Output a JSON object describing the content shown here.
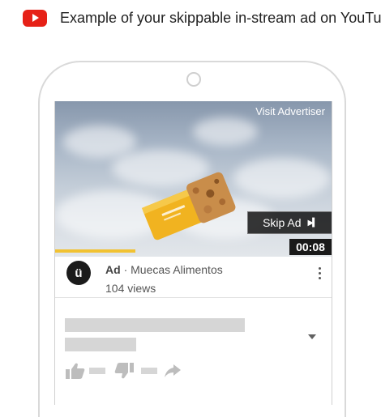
{
  "header": {
    "title": "Example of your skippable in-stream ad on YouTube"
  },
  "video": {
    "visit_label": "Visit Advertiser",
    "skip_label": "Skip Ad",
    "duration": "00:08",
    "progress_fraction": 0.29
  },
  "ad": {
    "badge": "Ad",
    "separator": "·",
    "advertiser": "Muecas Alimentos",
    "views": "104 views",
    "avatar_letter": "ü"
  },
  "colors": {
    "youtube_red": "#e62117",
    "progress": "#f1c232",
    "placeholder": "#d6d6d6"
  },
  "icons": [
    "youtube-logo-icon",
    "skip-next-icon",
    "more-vert-icon",
    "chevron-down-icon",
    "thumb-up-icon",
    "thumb-down-icon",
    "share-icon"
  ]
}
